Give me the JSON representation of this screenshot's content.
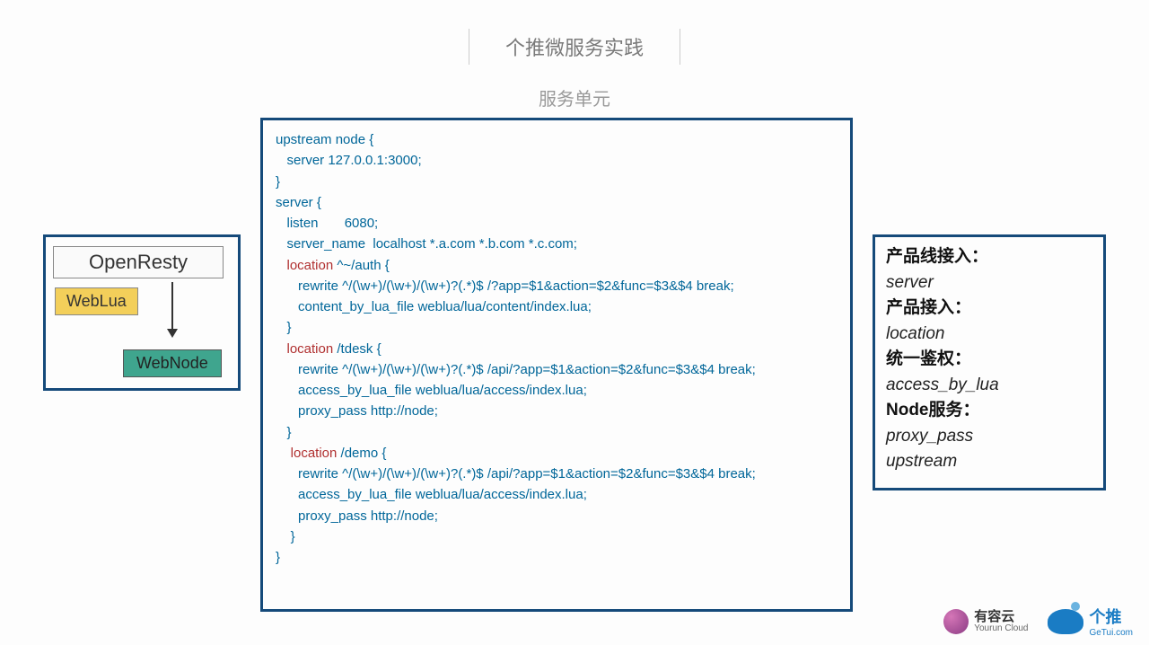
{
  "header": {
    "title": "个推微服务实践",
    "subtitle": "服务单元"
  },
  "diagram": {
    "root": "OpenResty",
    "child1": "WebLua",
    "child2": "WebNode"
  },
  "code": {
    "l1": "upstream node {",
    "l2": "   server 127.0.0.1:3000;",
    "l3": "}",
    "l4": "",
    "l5": "server {",
    "l6": "   listen       6080;",
    "l7": "   server_name  localhost *.a.com *.b.com *.c.com;",
    "l8": "",
    "l9a": "   location",
    "l9b": " ^~/auth {",
    "l10": "      rewrite ^/(\\w+)/(\\w+)/(\\w+)?(.*)$ /?app=$1&action=$2&func=$3&$4 break;",
    "l11": "      content_by_lua_file weblua/lua/content/index.lua;",
    "l12": "   }",
    "l13": "",
    "l14a": "   location",
    "l14b": " /tdesk {",
    "l15": "      rewrite ^/(\\w+)/(\\w+)/(\\w+)?(.*)$ /api/?app=$1&action=$2&func=$3&$4 break;",
    "l16": "      access_by_lua_file weblua/lua/access/index.lua;",
    "l17": "      proxy_pass http://node;",
    "l18": "   }",
    "l19": "",
    "l20a": "    location",
    "l20b": " /demo {",
    "l21": "      rewrite ^/(\\w+)/(\\w+)/(\\w+)?(.*)$ /api/?app=$1&action=$2&func=$3&$4 break;",
    "l22": "      access_by_lua_file weblua/lua/access/index.lua;",
    "l23": "      proxy_pass http://node;",
    "l24": "    }",
    "l25": "}"
  },
  "annotations": {
    "r1_zh": "产品线接入：",
    "r1_en": "server",
    "r2_zh": "产品接入：",
    "r2_en": "location",
    "r3_zh": "统一鉴权：",
    "r3_en": "access_by_lua",
    "r4_zh": "Node服务：",
    "r4_en1": "proxy_pass",
    "r4_en2": "upstream"
  },
  "logos": {
    "yourun_cn": "有容云",
    "yourun_en": "Yourun Cloud",
    "getui_cn": "个推",
    "getui_en": "GeTui.com"
  }
}
